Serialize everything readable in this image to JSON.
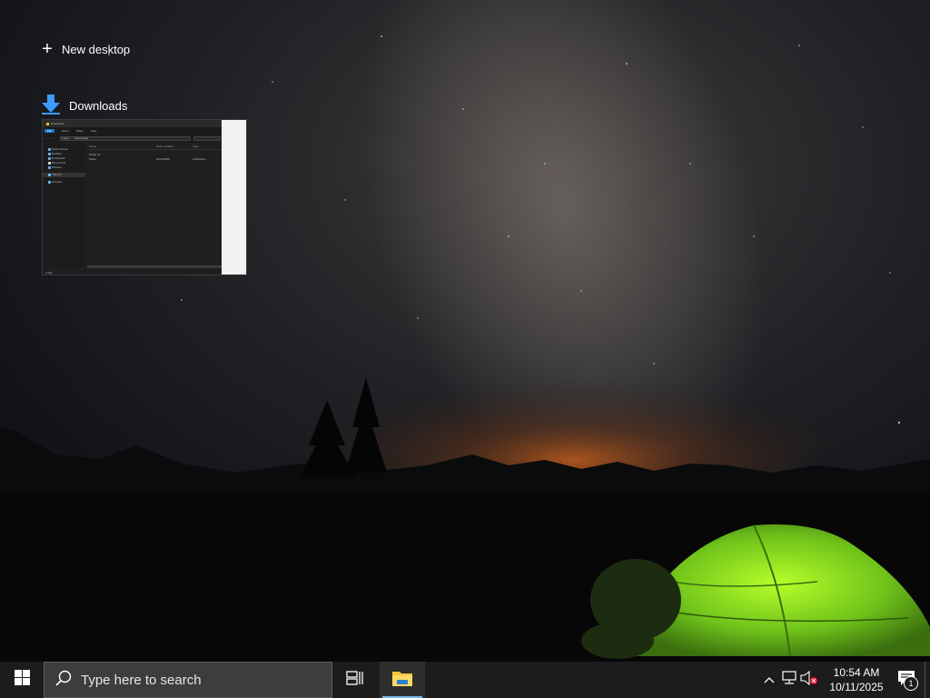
{
  "task_view": {
    "new_desktop_label": "New desktop",
    "window": {
      "title": "Downloads",
      "icon": "download-arrow-icon",
      "thumbnail": {
        "titlebar_text": "Downloads",
        "ribbon_tabs": [
          "File",
          "Home",
          "Share",
          "View"
        ],
        "path": [
          "Users",
          "Downloads"
        ],
        "nav_items": [
          "Quick access",
          "Desktop",
          "Downloads",
          "Documents",
          "Pictures",
          "This PC",
          "Network"
        ],
        "columns": [
          "Name",
          "Date modified",
          "Type"
        ],
        "group_label": "Today (1)",
        "file": {
          "name": "Setup",
          "date": "10/11/2025",
          "type": "Application"
        },
        "status": "1 item"
      }
    }
  },
  "taskbar": {
    "start_icon": "windows-logo-icon",
    "search_placeholder": "Type here to search",
    "task_view_icon": "task-view-icon",
    "pinned_apps": [
      {
        "name": "File Explorer",
        "icon": "file-explorer-icon",
        "active": true
      }
    ],
    "tray": {
      "chevron_icon": "show-hidden-icons-chevron",
      "network_icon": "network-icon",
      "volume_icon": "volume-muted-icon",
      "time": "10:54 AM",
      "date": "10/11/2025",
      "notification_count": "1"
    }
  },
  "colors": {
    "taskbar_bg": "#1c1c1c",
    "search_bg": "#3d3d3d",
    "accent": "#76b9ed",
    "windows_logo": "#ffffff"
  }
}
